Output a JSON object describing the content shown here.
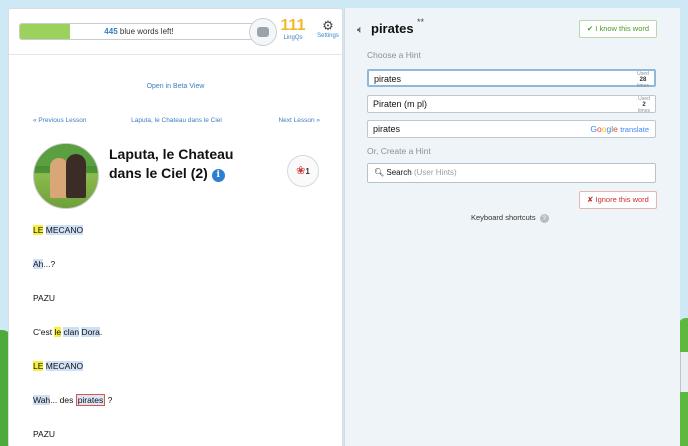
{
  "topbar": {
    "progress": {
      "count": "445",
      "suffix": "blue words left!",
      "fill_fraction": 0.21
    },
    "lingqs": {
      "count": "111",
      "label": "LingQs"
    },
    "settings_label": "Settings"
  },
  "lesson": {
    "beta_link": "Open in Beta View",
    "prev": "« Previous Lesson",
    "current": "Laputa, le Chateau dans le Ciel",
    "next": "Next Lesson »",
    "title": "Laputa, le Chateau dans le Ciel (2)",
    "rose_count": "1",
    "lines": [
      [
        {
          "t": "LE",
          "s": "y"
        },
        {
          "t": " ",
          "s": ""
        },
        {
          "t": "MECANO",
          "s": "b"
        }
      ],
      [
        {
          "t": "Ah",
          "s": "b"
        },
        {
          "t": "...?",
          "s": ""
        }
      ],
      [
        {
          "t": "PAZU",
          "s": ""
        }
      ],
      [
        {
          "t": "C'est ",
          "s": ""
        },
        {
          "t": "le",
          "s": "y"
        },
        {
          "t": " ",
          "s": ""
        },
        {
          "t": "clan",
          "s": "b"
        },
        {
          "t": " ",
          "s": ""
        },
        {
          "t": "Dora",
          "s": "b"
        },
        {
          "t": ".",
          "s": ""
        }
      ],
      [
        {
          "t": "LE",
          "s": "y"
        },
        {
          "t": " ",
          "s": ""
        },
        {
          "t": "MECANO",
          "s": "b"
        }
      ],
      [
        {
          "t": "Wah",
          "s": "b"
        },
        {
          "t": "... des ",
          "s": ""
        },
        {
          "t": "pirates",
          "s": "sel"
        },
        {
          "t": " ?",
          "s": ""
        }
      ],
      [
        {
          "t": "PAZU",
          "s": ""
        }
      ]
    ]
  },
  "hint_panel": {
    "term": "pirates",
    "stars": "**",
    "know_button": "✔ I know this word",
    "choose_label": "Choose a Hint",
    "hints": [
      {
        "text": "pirates",
        "used_label": "Used",
        "used_count": "28",
        "used_suffix": "times"
      },
      {
        "text": "Piraten (m pl)",
        "used_label": "Used",
        "used_count": "2",
        "used_suffix": "times"
      }
    ],
    "google_hint": "pirates",
    "google_brand": "Google",
    "google_translate": "translate",
    "create_label": "Or, Create a Hint",
    "search_label": "Search",
    "search_hint": "(User Hints)",
    "ignore_button": "✘ Ignore this word",
    "keyboard_shortcuts": "Keyboard shortcuts",
    "help_glyph": "?"
  },
  "icons": {
    "settings": "gear-icon",
    "speaker": "speaker-icon",
    "info": "info-icon",
    "rose": "rose-icon",
    "search": "search-icon"
  }
}
